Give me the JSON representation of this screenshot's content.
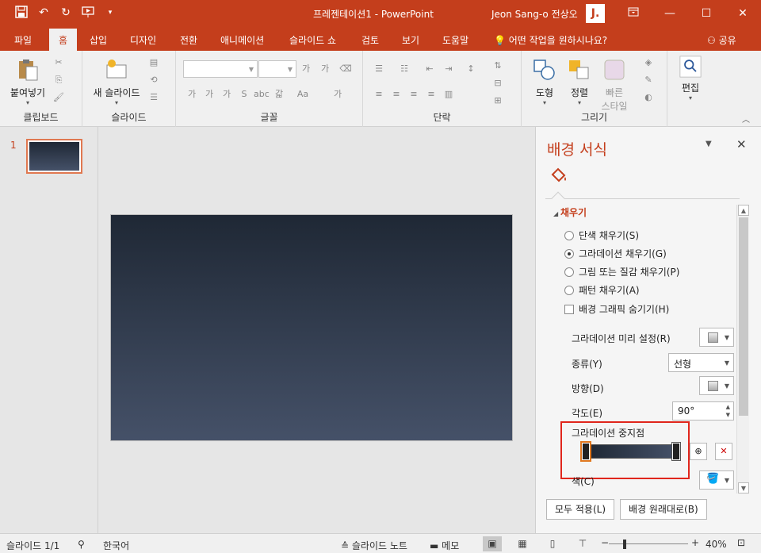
{
  "window": {
    "title": "프레젠테이션1  -  PowerPoint",
    "user_name": "Jeon Sang-o 전상오",
    "user_initial": "J."
  },
  "tabs": [
    "파일",
    "홈",
    "삽입",
    "디자인",
    "전환",
    "애니메이션",
    "슬라이드 쇼",
    "검토",
    "보기",
    "도움말"
  ],
  "active_tab": "홈",
  "tell_me": "어떤 작업을 원하시나요?",
  "share": "공유",
  "ribbon": {
    "paste": "붙여넣기",
    "new_slide": "새 슬라이드",
    "groups": {
      "clipboard": "클립보드",
      "slides": "슬라이드",
      "font": "글꼴",
      "paragraph": "단락",
      "drawing": "그리기",
      "editing": "편집"
    },
    "font_buttons": [
      "가",
      "가",
      "가",
      "S",
      "abc",
      "갋",
      "Aa",
      "가"
    ],
    "shapes": "도형",
    "arrange": "정렬",
    "quick_styles_line1": "빠른",
    "quick_styles_line2": "스타일",
    "editing_btn": "편집"
  },
  "thumbnails": {
    "slide_number": "1"
  },
  "format_panel": {
    "title": "배경 서식",
    "section": "채우기",
    "fill_options": [
      {
        "label": "단색 채우기(S)",
        "selected": false
      },
      {
        "label": "그라데이션 채우기(G)",
        "selected": true
      },
      {
        "label": "그림 또는 질감 채우기(P)",
        "selected": false
      },
      {
        "label": "패턴 채우기(A)",
        "selected": false
      }
    ],
    "hide_graphics": {
      "label": "배경 그래픽 숨기기(H)",
      "checked": false
    },
    "preset_label": "그라데이션 미리 설정(R)",
    "type_label": "종류(Y)",
    "type_value": "선형",
    "direction_label": "방향(D)",
    "angle_label": "각도(E)",
    "angle_value": "90°",
    "stops_label": "그라데이션 중지점",
    "color_label": "색(C)",
    "apply_all": "모두 적용(L)",
    "reset": "배경 원래대로(B)"
  },
  "status": {
    "slide_counter": "슬라이드 1/1",
    "language": "한국어",
    "notes": "슬라이드 노트",
    "comments": "메모",
    "zoom": "40%"
  },
  "colors": {
    "accent": "#c43e1c",
    "slide_top": "#1f2835",
    "slide_bottom": "#455168"
  }
}
